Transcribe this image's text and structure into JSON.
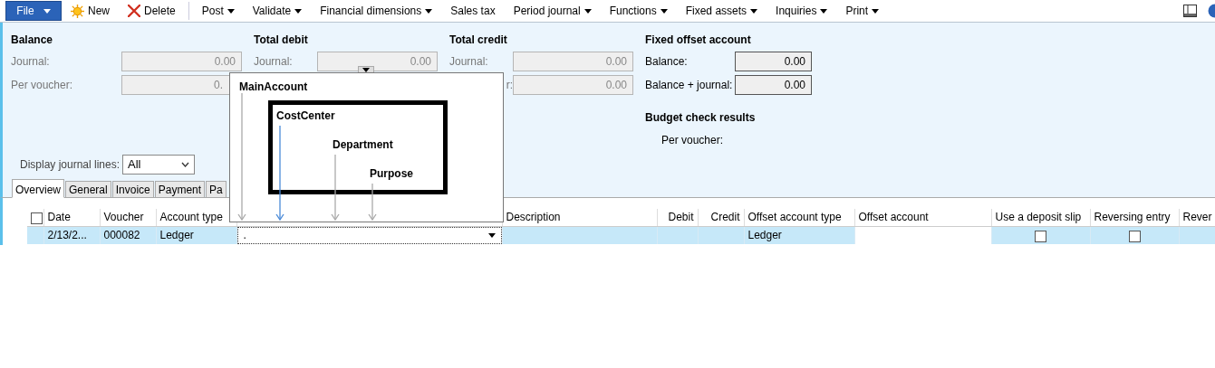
{
  "toolbar": {
    "file_button": "File",
    "actions": [
      {
        "label": "New"
      },
      {
        "label": "Delete"
      }
    ],
    "menus": [
      {
        "label": "Post",
        "has_menu": true
      },
      {
        "label": "Validate",
        "has_menu": true
      },
      {
        "label": "Financial dimensions",
        "has_menu": true
      },
      {
        "label": "Sales tax",
        "has_menu": false
      },
      {
        "label": "Period journal",
        "has_menu": true
      },
      {
        "label": "Functions",
        "has_menu": true
      },
      {
        "label": "Fixed assets",
        "has_menu": true
      },
      {
        "label": "Inquiries",
        "has_menu": true
      },
      {
        "label": "Print",
        "has_menu": true
      }
    ]
  },
  "summary": [
    {
      "title": "Balance",
      "rows": [
        {
          "label": "Journal:",
          "value": "0.00",
          "disabled": true
        },
        {
          "label": "Per voucher:",
          "value": "0.",
          "disabled": true
        }
      ]
    },
    {
      "title": "Total debit",
      "rows": [
        {
          "label": "Journal:",
          "value": "0.00",
          "disabled": true
        }
      ]
    },
    {
      "title": "Total credit",
      "rows": [
        {
          "label": "Journal:",
          "value": "0.00",
          "disabled": true
        },
        {
          "label": "r:",
          "value": "0.00",
          "disabled": true
        }
      ]
    },
    {
      "title": "Fixed offset account",
      "rows": [
        {
          "label": "Balance:",
          "value": "0.00",
          "disabled": false
        },
        {
          "label": "Balance + journal:",
          "value": "0.00",
          "disabled": false
        }
      ]
    }
  ],
  "budget": {
    "title": "Budget check results",
    "label": "Per voucher:"
  },
  "display_lines": {
    "label": "Display journal lines:",
    "value": "All"
  },
  "tabs": [
    {
      "label": "Overview",
      "selected": true
    },
    {
      "label": "General",
      "selected": false
    },
    {
      "label": "Invoice",
      "selected": false
    },
    {
      "label": "Payment",
      "selected": false
    },
    {
      "label": "Pa",
      "selected": false
    }
  ],
  "grid": {
    "select_all": false,
    "columns": [
      "Date",
      "Voucher",
      "Account type",
      "",
      "Description",
      "Debit",
      "Credit",
      "Offset account type",
      "Offset account",
      "Use a deposit slip",
      "Reversing entry",
      "Rever"
    ],
    "rows": [
      {
        "selected": true,
        "date": "2/13/2...",
        "voucher": "000082",
        "account_type": "Ledger",
        "account": ".",
        "description": "",
        "debit": "",
        "credit": "",
        "offset_account_type": "Ledger",
        "use_deposit_slip": false,
        "reversing_entry": false
      }
    ]
  },
  "dimension_popup": {
    "segments": [
      {
        "label": "MainAccount",
        "highlighted": false
      },
      {
        "label": "CostCenter",
        "highlighted": true
      },
      {
        "label": "Department",
        "highlighted": false
      },
      {
        "label": "Purpose",
        "highlighted": false
      }
    ]
  }
}
